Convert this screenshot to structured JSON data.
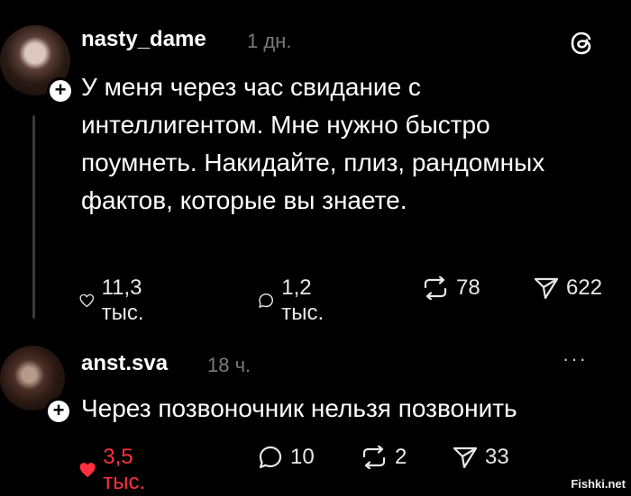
{
  "posts": [
    {
      "username": "nasty_dame",
      "time": "1 дн.",
      "text": "У меня через час свидание с интеллигентом. Мне нужно быстро поумнеть. Накидайте, плиз, рандомных фактов, которые вы знаете.",
      "likes": "11,3 тыс.",
      "replies": "1,2 тыс.",
      "reposts": "78",
      "shares": "622",
      "liked": false
    },
    {
      "username": "anst.sva",
      "time": "18 ч.",
      "text": "Через позвоночник нельзя позвонить",
      "likes": "3,5 тыс.",
      "replies": "10",
      "reposts": "2",
      "shares": "33",
      "liked": true
    }
  ],
  "icons": {
    "follow": "+",
    "more": "···",
    "logo": "threads-logo"
  },
  "colors": {
    "background": "#000000",
    "liked": "#ff3040",
    "muted": "#7a7a7a"
  },
  "watermark": "Fishki.net"
}
